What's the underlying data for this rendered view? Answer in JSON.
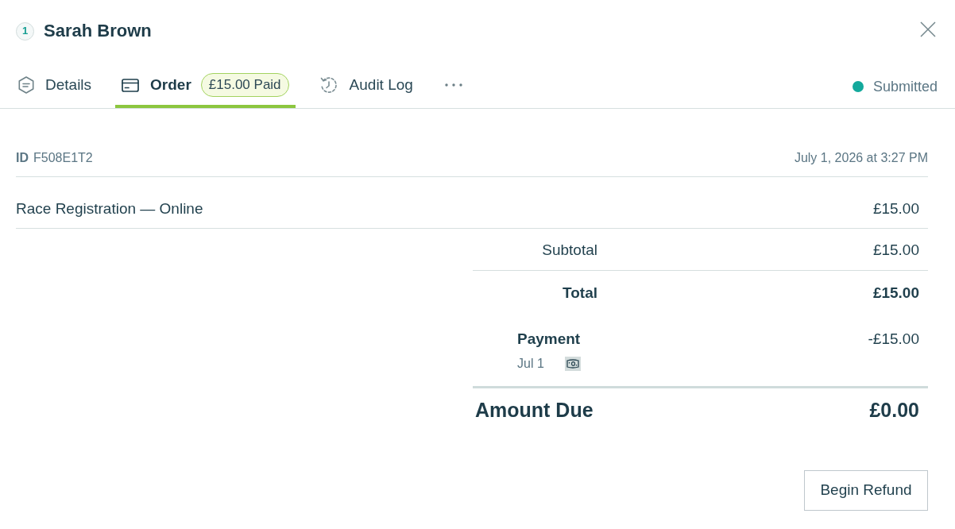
{
  "header": {
    "step_number": "1",
    "title": "Sarah Brown"
  },
  "tabs": [
    {
      "label": "Details",
      "selected": false
    },
    {
      "label": "Order",
      "selected": true,
      "badge": "£15.00 Paid"
    },
    {
      "label": "Audit Log",
      "selected": false
    }
  ],
  "status": {
    "label": "Submitted"
  },
  "order": {
    "id_label": "ID",
    "id": "F508E1T2",
    "date": "July 1, 2026 at 3:27 PM",
    "line_items": [
      {
        "description": "Race Registration — Online",
        "amount": "£15.00"
      }
    ],
    "subtotal": {
      "label": "Subtotal",
      "amount": "£15.00"
    },
    "total": {
      "label": "Total",
      "amount": "£15.00"
    },
    "payments": [
      {
        "label": "Payment",
        "date": "Jul 1",
        "amount": "-£15.00"
      }
    ],
    "amount_due": {
      "label": "Amount Due",
      "amount": "£0.00"
    }
  },
  "actions": [
    {
      "label": "Begin Refund"
    }
  ]
}
